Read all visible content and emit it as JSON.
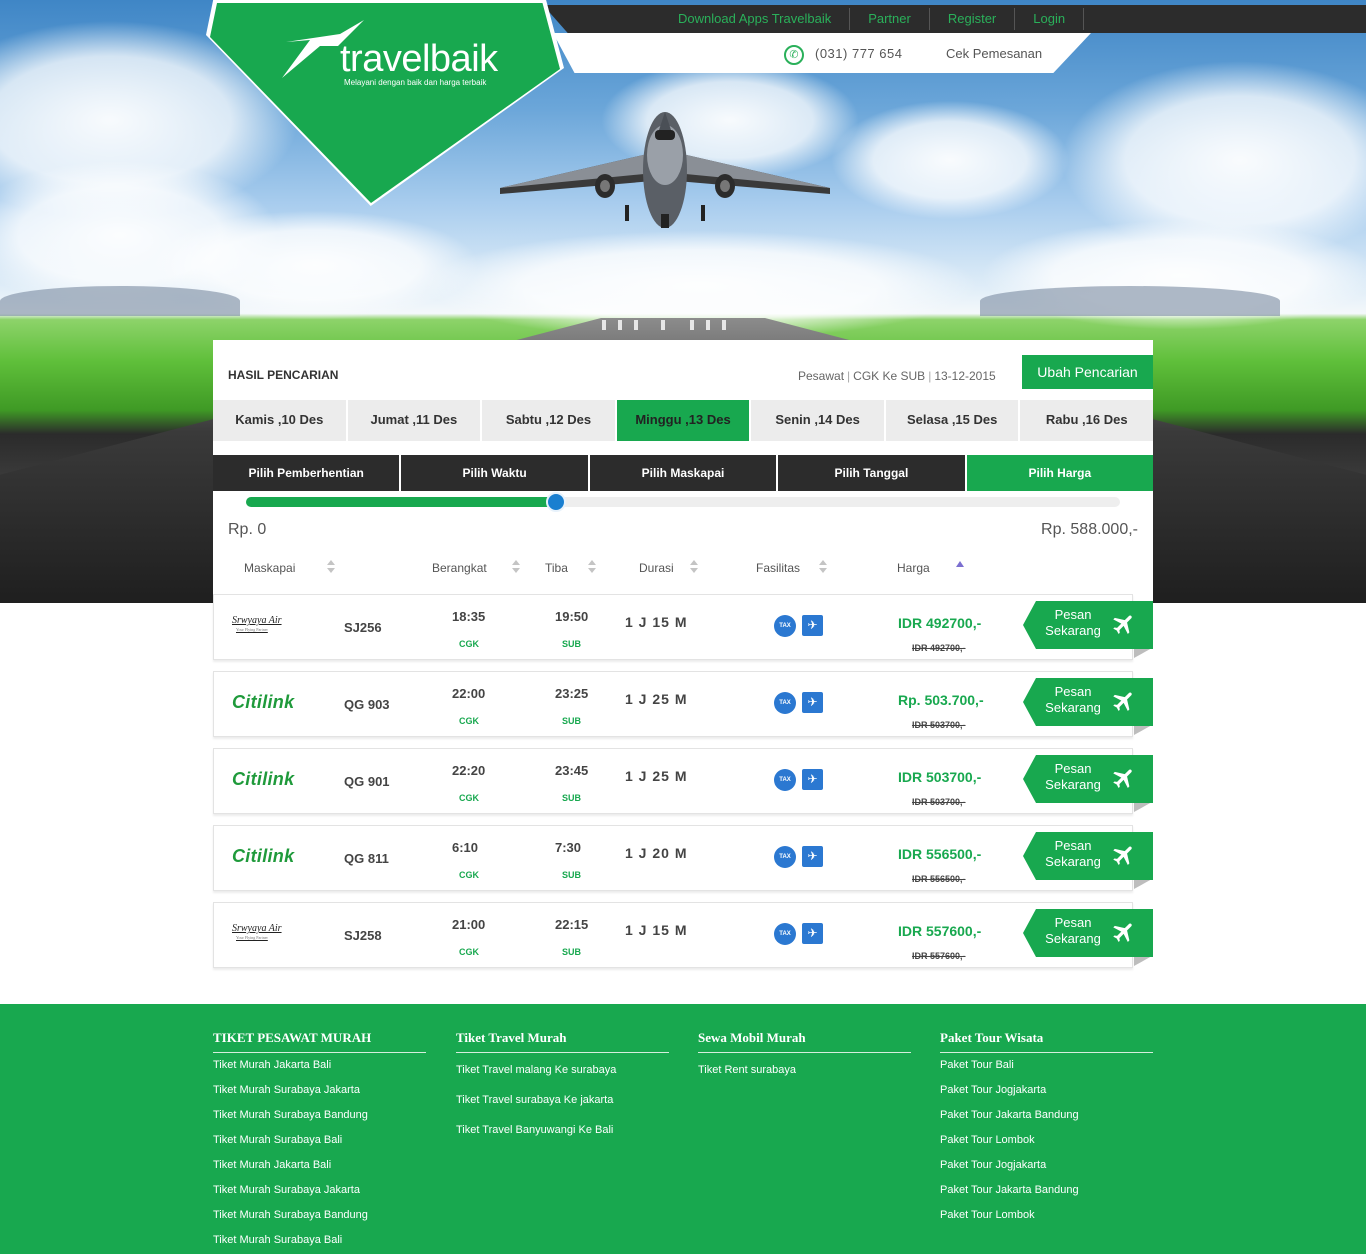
{
  "brand": {
    "name": "travelbaik",
    "tagline": "Melayani dengan baik dan harga terbaik"
  },
  "topnav": {
    "links": [
      "Download Apps Travelbaik",
      "Partner",
      "Register",
      "Login"
    ],
    "phone": "(031) 777 654",
    "cek": "Cek Pemesanan"
  },
  "search": {
    "title": "HASIL PENCARIAN",
    "type": "Pesawat",
    "route": "CGK Ke SUB",
    "date": "13-12-2015",
    "change_label": "Ubah Pencarian"
  },
  "days": [
    {
      "label": "Kamis ,10 Des",
      "active": false
    },
    {
      "label": "Jumat ,11 Des",
      "active": false
    },
    {
      "label": "Sabtu ,12 Des",
      "active": false
    },
    {
      "label": "Minggu ,13 Des",
      "active": true
    },
    {
      "label": "Senin ,14 Des",
      "active": false
    },
    {
      "label": "Selasa ,15 Des",
      "active": false
    },
    {
      "label": "Rabu ,16 Des",
      "active": false
    }
  ],
  "filters": [
    {
      "label": "Pilih Pemberhentian",
      "active": false
    },
    {
      "label": "Pilih Waktu",
      "active": false
    },
    {
      "label": "Pilih Maskapai",
      "active": false
    },
    {
      "label": "Pilih Tanggal",
      "active": false
    },
    {
      "label": "Pilih Harga",
      "active": true
    }
  ],
  "price_range": {
    "min_label": "Rp. 0",
    "max_label": "Rp. 588.000,-",
    "level": 0.355
  },
  "columns": [
    "Maskapai",
    "Berangkat",
    "Tiba",
    "Durasi",
    "Fasilitas",
    "Harga"
  ],
  "flights": [
    {
      "airline": "Srwyaya Air",
      "airline_sub": "Your Flying Partner",
      "logo": "sriwijaya",
      "code": "SJ256",
      "dep": "18:35",
      "dep_code": "CGK",
      "arr": "19:50",
      "arr_code": "SUB",
      "duration": "1 J 15 M",
      "price": "IDR 492700,-",
      "old_price": "IDR 492700,-"
    },
    {
      "airline": "Citilink",
      "airline_sub": "",
      "logo": "citilink",
      "code": "QG 903",
      "dep": "22:00",
      "dep_code": "CGK",
      "arr": "23:25",
      "arr_code": "SUB",
      "duration": "1 J 25 M",
      "price": "Rp. 503.700,-",
      "old_price": "IDR 503700,-"
    },
    {
      "airline": "Citilink",
      "airline_sub": "",
      "logo": "citilink",
      "code": "QG 901",
      "dep": "22:20",
      "dep_code": "CGK",
      "arr": "23:45",
      "arr_code": "SUB",
      "duration": "1 J 25 M",
      "price": "IDR 503700,-",
      "old_price": "IDR 503700,-"
    },
    {
      "airline": "Citilink",
      "airline_sub": "",
      "logo": "citilink",
      "code": "QG 811",
      "dep": "6:10",
      "dep_code": "CGK",
      "arr": "7:30",
      "arr_code": "SUB",
      "duration": "1 J 20 M",
      "price": "IDR 556500,-",
      "old_price": "IDR 556500,-"
    },
    {
      "airline": "Srwyaya Air",
      "airline_sub": "Your Flying Partner",
      "logo": "sriwijaya",
      "code": "SJ258",
      "dep": "21:00",
      "dep_code": "CGK",
      "arr": "22:15",
      "arr_code": "SUB",
      "duration": "1 J 15 M",
      "price": "IDR 557600,-",
      "old_price": "IDR 557600,-"
    }
  ],
  "book_label_1": "Pesan",
  "book_label_2": "Sekarang",
  "facility_tax": "TAX",
  "footer": [
    {
      "heading": "TIKET PESAWAT MURAH",
      "links": [
        "Tiket Murah Jakarta Bali",
        "Tiket Murah Surabaya Jakarta",
        "Tiket Murah Surabaya Bandung",
        "Tiket Murah Surabaya Bali",
        "Tiket Murah Jakarta Bali",
        "Tiket Murah Surabaya Jakarta",
        "Tiket Murah Surabaya Bandung",
        "Tiket Murah Surabaya Bali"
      ]
    },
    {
      "heading": "Tiket Travel Murah",
      "links": [
        "Tiket Travel malang Ke surabaya",
        "Tiket Travel surabaya Ke jakarta",
        "Tiket Travel Banyuwangi Ke Bali"
      ]
    },
    {
      "heading": "Sewa Mobil Murah",
      "links": [
        "Tiket Rent surabaya"
      ]
    },
    {
      "heading": "Paket Tour Wisata",
      "links": [
        "Paket Tour Bali",
        "Paket Tour Jogjakarta",
        "Paket Tour Jakarta Bandung",
        "Paket Tour Lombok",
        "Paket Tour Jogjakarta",
        "Paket Tour Jakarta Bandung",
        "Paket Tour Lombok"
      ]
    }
  ],
  "colors": {
    "brand_green": "#18a84f",
    "dark": "#2c2c2c",
    "slider_knob": "#1a7fd0"
  }
}
